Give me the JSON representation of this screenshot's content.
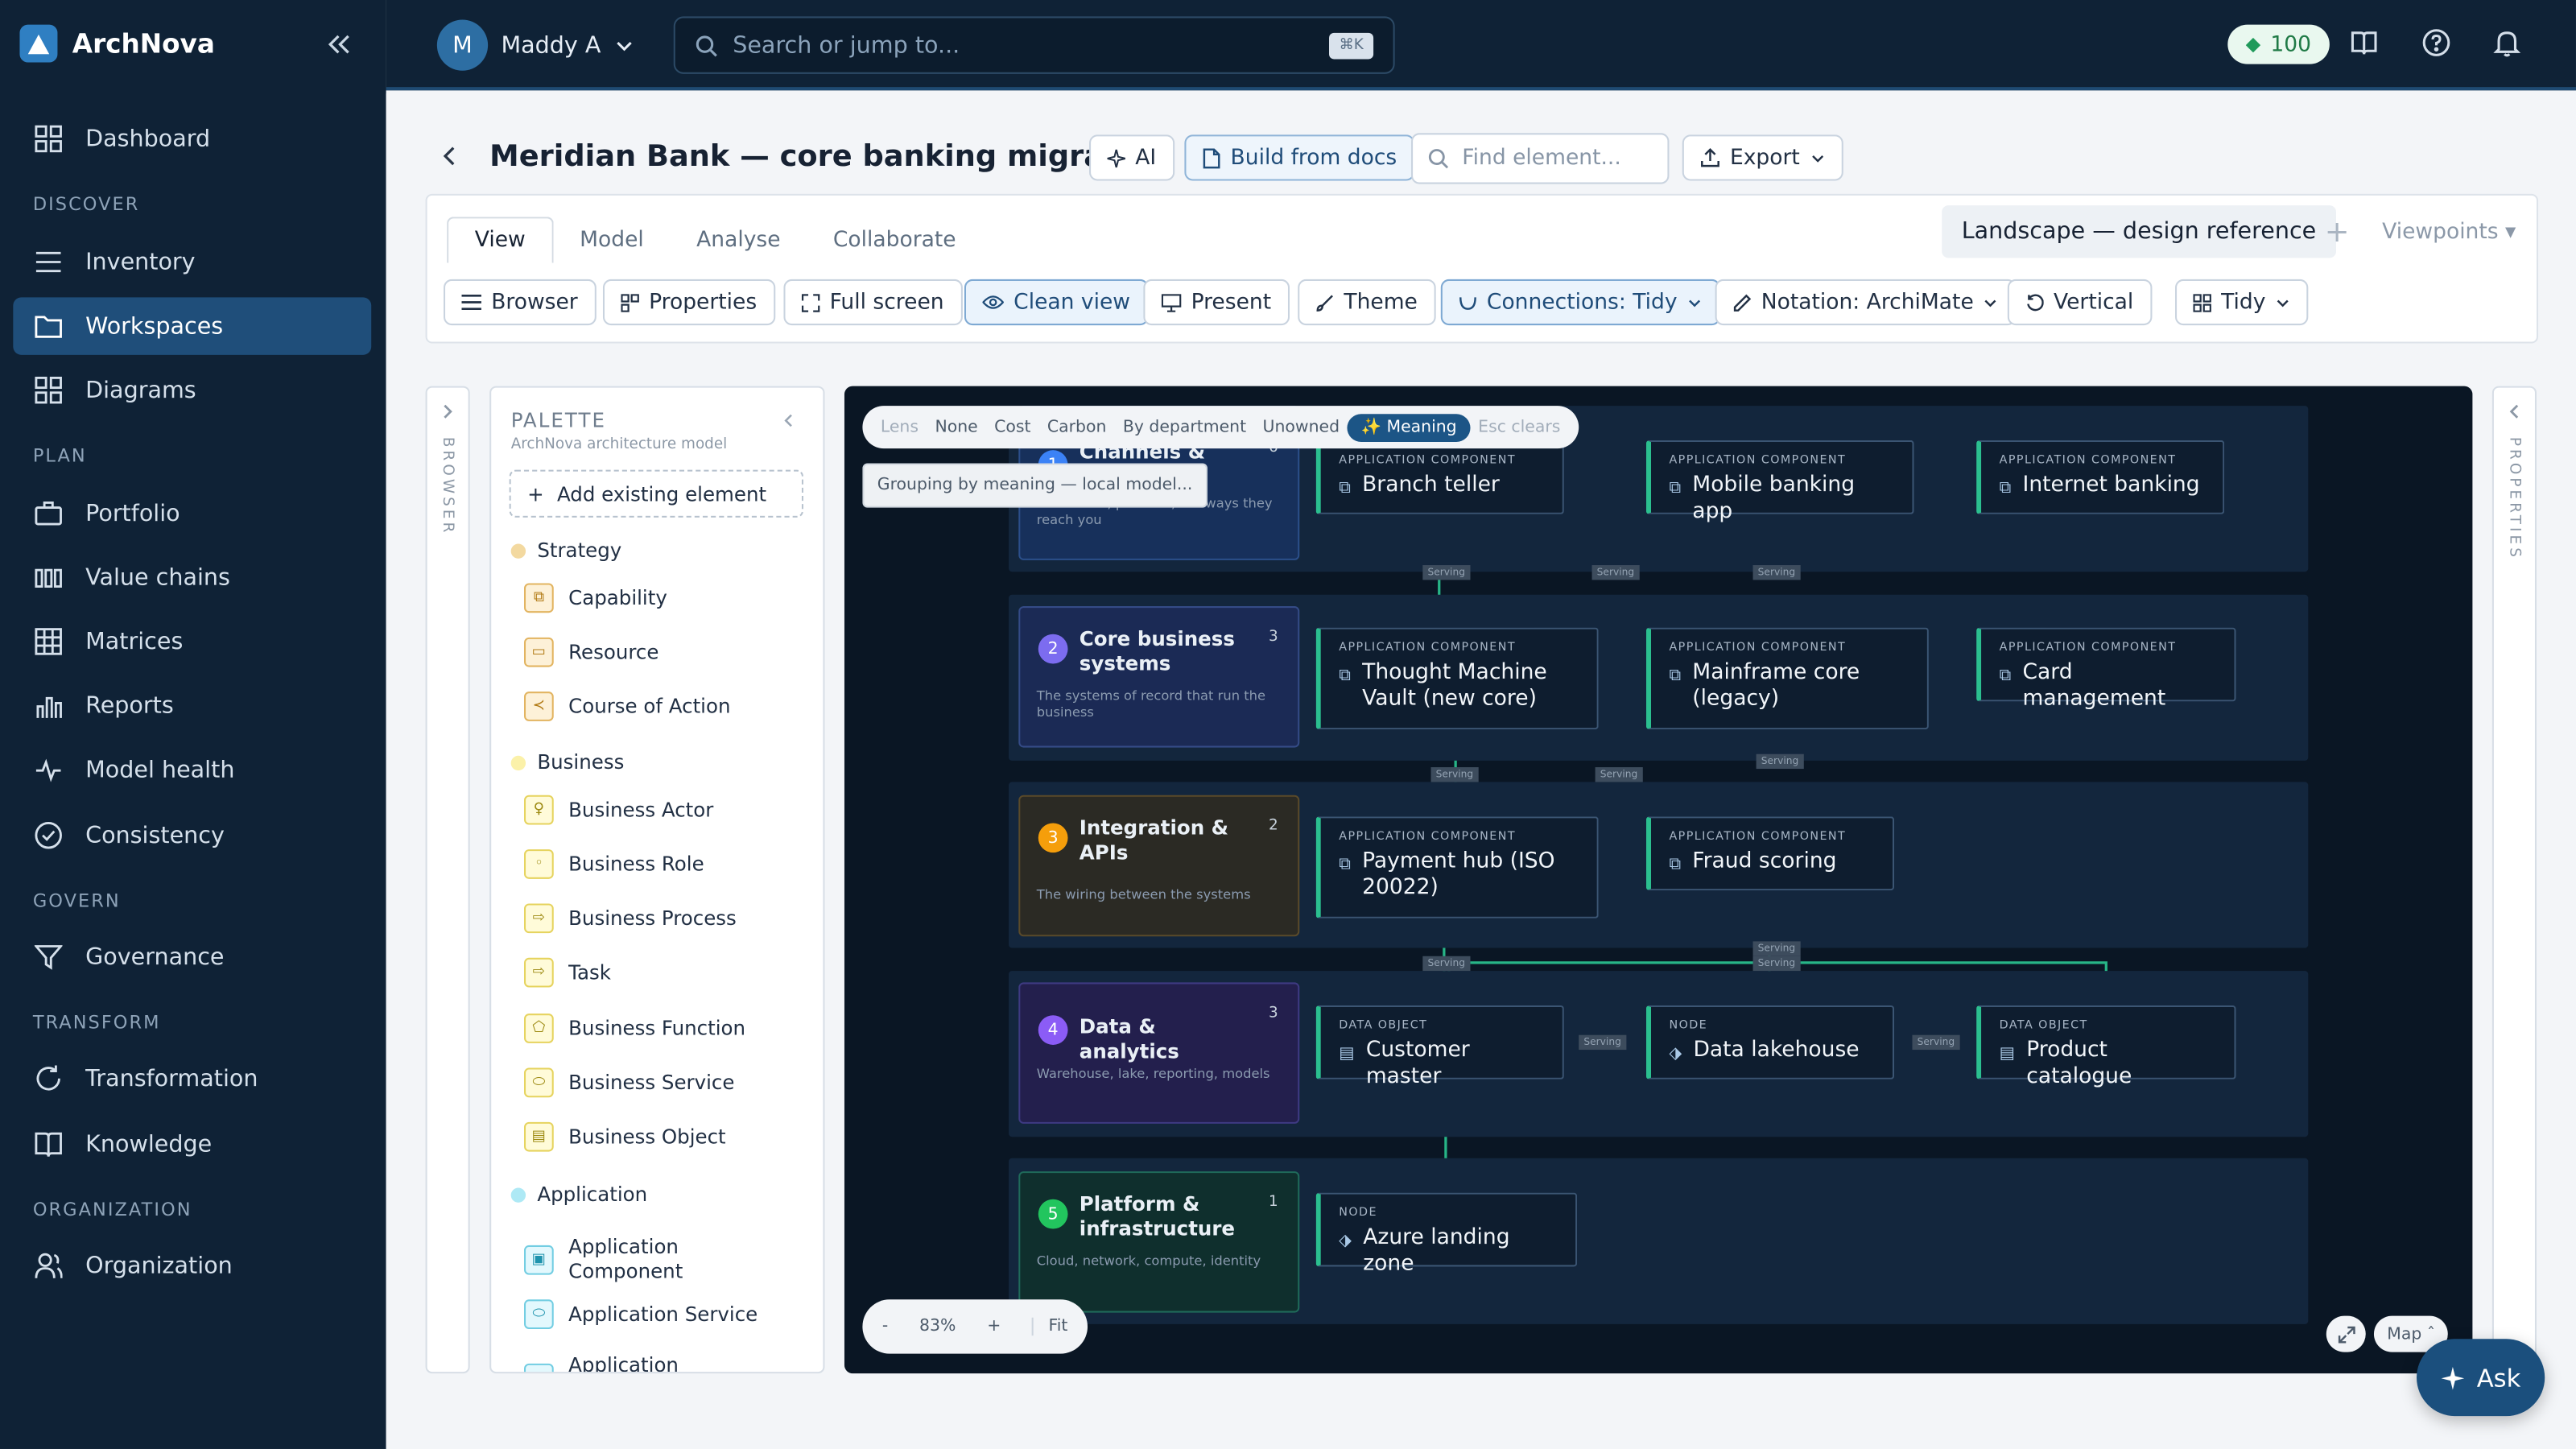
{
  "app": {
    "name": "ArchNova"
  },
  "sidebar": {
    "items": [
      {
        "label": "Dashboard",
        "icon": "grid-icon"
      },
      {
        "label": "Inventory",
        "icon": "list-icon"
      },
      {
        "label": "Workspaces",
        "icon": "folder-icon"
      },
      {
        "label": "Diagrams",
        "icon": "grid-icon"
      },
      {
        "label": "Portfolio",
        "icon": "briefcase-icon"
      },
      {
        "label": "Value chains",
        "icon": "columns-icon"
      },
      {
        "label": "Matrices",
        "icon": "table-icon"
      },
      {
        "label": "Reports",
        "icon": "bar-chart-icon"
      },
      {
        "label": "Model health",
        "icon": "pulse-icon"
      },
      {
        "label": "Consistency",
        "icon": "check-circle-icon"
      },
      {
        "label": "Governance",
        "icon": "filter-icon"
      },
      {
        "label": "Transformation",
        "icon": "refresh-icon"
      },
      {
        "label": "Knowledge",
        "icon": "book-icon"
      },
      {
        "label": "Organization",
        "icon": "users-icon"
      }
    ],
    "sections": [
      "DISCOVER",
      "PLAN",
      "GOVERN",
      "TRANSFORM",
      "ORGANIZATION"
    ],
    "active": "Workspaces"
  },
  "topbar": {
    "user_initial": "M",
    "user_name": "Maddy A",
    "search_placeholder": "Search or jump to...",
    "search_shortcut": "⌘K",
    "credits": "100"
  },
  "header": {
    "title": "Meridian Bank — core banking migration",
    "ai_label": "AI",
    "build_label": "Build from docs",
    "find_placeholder": "Find element...",
    "export_label": "Export"
  },
  "tabs": [
    "View",
    "Model",
    "Analyse",
    "Collaborate"
  ],
  "viewpoint": {
    "current": "Landscape — design reference",
    "menu": "Viewpoints"
  },
  "toolbar": {
    "browser": "Browser",
    "properties": "Properties",
    "fullscreen": "Full screen",
    "clean_view": "Clean view",
    "present": "Present",
    "theme": "Theme",
    "connections": "Connections: Tidy",
    "notation": "Notation: ArchiMate",
    "vertical": "Vertical",
    "tidy": "Tidy"
  },
  "rails": {
    "left": "BROWSER",
    "right": "PROPERTIES"
  },
  "palette": {
    "title": "PALETTE",
    "subtitle": "ArchNova architecture model",
    "add_label": "Add existing element",
    "groups": [
      {
        "name": "Strategy",
        "color": "#f3d9a0",
        "items": [
          "Capability",
          "Resource",
          "Course of Action"
        ]
      },
      {
        "name": "Business",
        "color": "#fbf1a9",
        "items": [
          "Business Actor",
          "Business Role",
          "Business Process",
          "Task",
          "Business Function",
          "Business Service",
          "Business Object"
        ]
      },
      {
        "name": "Application",
        "color": "#aee9f5",
        "items": [
          "Application Component",
          "Application Service",
          "Application Interface"
        ]
      }
    ]
  },
  "canvas": {
    "lens": {
      "label": "Lens",
      "options": [
        "None",
        "Cost",
        "Carbon",
        "By department",
        "Unowned"
      ],
      "active": "✨ Meaning",
      "hint": "Esc clears"
    },
    "tooltip": "Grouping by meaning — local model...",
    "lanes": [
      {
        "n": "1",
        "title": "Channels &",
        "count": "6",
        "desc": "Customers, partners, the ways they reach you",
        "color": "#3b82f6"
      },
      {
        "n": "2",
        "title": "Core business systems",
        "count": "3",
        "desc": "The systems of record that run the business",
        "color": "#7c6cf0"
      },
      {
        "n": "3",
        "title": "Integration & APIs",
        "count": "2",
        "desc": "The wiring between the systems",
        "color": "#f59e0b"
      },
      {
        "n": "4",
        "title": "Data & analytics",
        "count": "3",
        "desc": "Warehouse, lake, reporting, models",
        "color": "#8b5cf6"
      },
      {
        "n": "5",
        "title": "Platform & infrastructure",
        "count": "1",
        "desc": "Cloud, network, compute, identity",
        "color": "#22c55e"
      }
    ],
    "elements": [
      {
        "type": "APPLICATION COMPONENT",
        "name": "Branch teller"
      },
      {
        "type": "APPLICATION COMPONENT",
        "name": "Mobile banking app"
      },
      {
        "type": "APPLICATION COMPONENT",
        "name": "Internet banking"
      },
      {
        "type": "APPLICATION COMPONENT",
        "name": "Thought Machine Vault (new core)"
      },
      {
        "type": "APPLICATION COMPONENT",
        "name": "Mainframe core (legacy)"
      },
      {
        "type": "APPLICATION COMPONENT",
        "name": "Card management"
      },
      {
        "type": "APPLICATION COMPONENT",
        "name": "Payment hub (ISO 20022)"
      },
      {
        "type": "APPLICATION COMPONENT",
        "name": "Fraud scoring"
      },
      {
        "type": "DATA OBJECT",
        "name": "Customer master"
      },
      {
        "type": "NODE",
        "name": "Data lakehouse"
      },
      {
        "type": "DATA OBJECT",
        "name": "Product catalogue"
      },
      {
        "type": "NODE",
        "name": "Azure landing zone"
      }
    ],
    "edge_label": "Serving",
    "zoom": {
      "minus": "-",
      "value": "83%",
      "plus": "+",
      "fit": "Fit"
    },
    "map_label": "Map"
  },
  "ask_label": "Ask"
}
